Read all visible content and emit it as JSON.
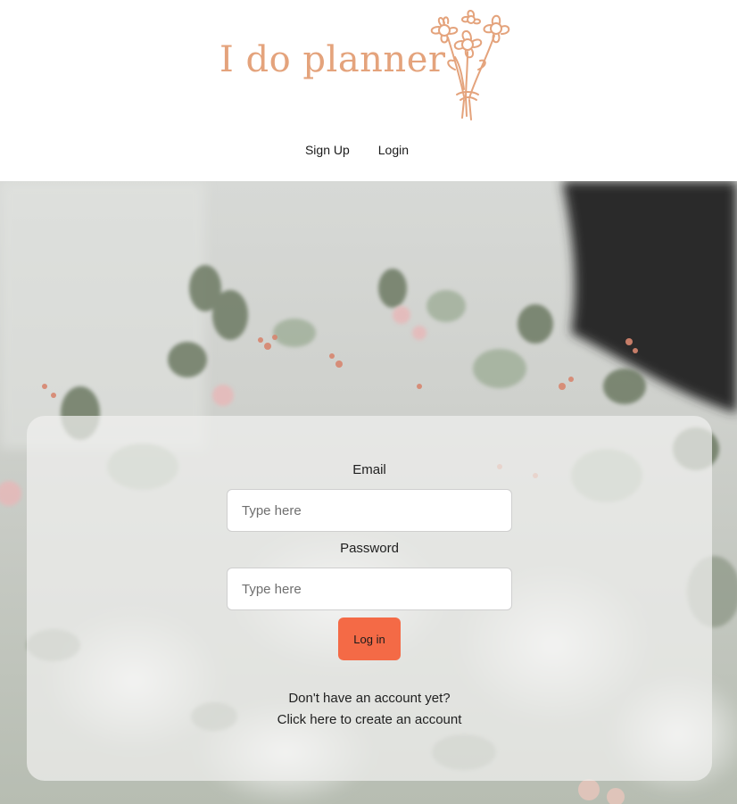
{
  "header": {
    "brand_title": "I do planner",
    "logo_icon": "flower-bouquet-icon",
    "brand_color": "#e4a37c"
  },
  "nav": {
    "items": [
      {
        "label": "Sign Up"
      },
      {
        "label": "Login"
      }
    ]
  },
  "login_form": {
    "email_label": "Email",
    "email_placeholder": "Type here",
    "email_value": "",
    "password_label": "Password",
    "password_placeholder": "Type here",
    "password_value": "",
    "submit_label": "Log in",
    "submit_color": "#f46a46",
    "no_account_text": "Don't have an account yet?",
    "create_account_link": "Click here to create an account"
  },
  "background": {
    "image": "floral-bouquet-photo"
  }
}
